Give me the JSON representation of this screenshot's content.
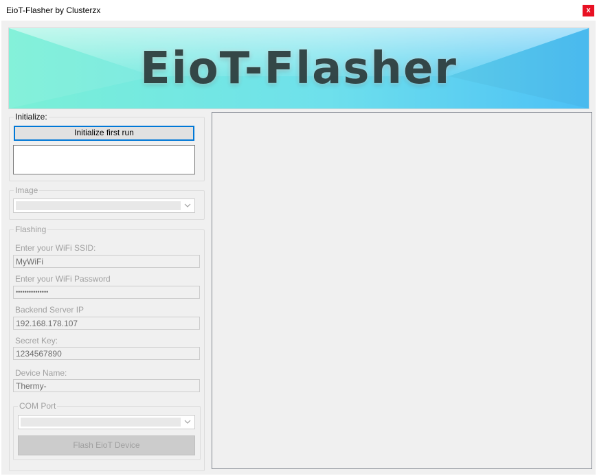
{
  "window": {
    "title": "EioT-Flasher by Clusterzx",
    "close_label": "x"
  },
  "banner": {
    "text": "EioT-Flasher"
  },
  "initialize": {
    "legend": "Initialize:",
    "button_label": "Initialize first run",
    "output_value": ""
  },
  "image": {
    "legend": "Image",
    "selected": ""
  },
  "flashing": {
    "legend": "Flashing",
    "ssid_label": "Enter your WiFi SSID:",
    "ssid_value": "MyWiFi",
    "password_label": "Enter your WiFi Password",
    "password_value": "•••••••••••••••",
    "server_label": "Backend Server IP",
    "server_value": "192.168.178.107",
    "secret_label": "Secret Key:",
    "secret_value": "1234567890",
    "device_label": "Device Name:",
    "device_value": "Thermy-",
    "com_legend": "COM Port",
    "com_selected": "",
    "flash_button_label": "Flash EioT Device"
  },
  "colors": {
    "accent": "#0078d7",
    "close": "#e81123",
    "banner_left": "#7af0d8",
    "banner_right": "#4fc3f7"
  }
}
